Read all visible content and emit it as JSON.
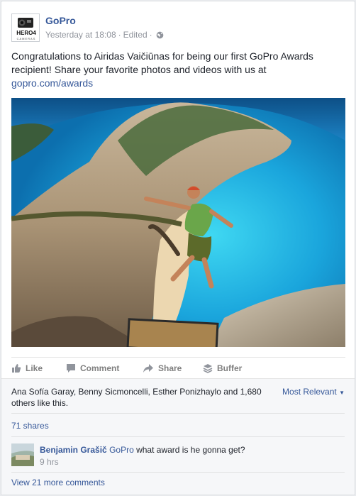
{
  "post": {
    "page_name": "GoPro",
    "timestamp": "Yesterday at 18:08",
    "edited_label": "Edited",
    "separator": "·",
    "audience_icon": "globe-icon",
    "avatar_text_main": "HERO4",
    "avatar_text_sub": "CAMERAS",
    "text": "Congratulations to Airidas Vaičiūnas for being our first GoPro Awards recipient! Share your favorite photos and videos with us at",
    "link": "gopro.com/awards"
  },
  "actions": {
    "like": "Like",
    "comment": "Comment",
    "share": "Share",
    "buffer": "Buffer"
  },
  "summary": {
    "likes_text": "Ana Sofía Garay, Benny Sicmoncelli, Esther Ponizhaylo and 1,680 others like this.",
    "sort_label": "Most Relevant",
    "shares": "71 shares"
  },
  "comments": [
    {
      "author": "Benjamin Grašič",
      "tag": "GoPro",
      "text": "what award is he gonna get?",
      "time": "9 hrs"
    }
  ],
  "view_more": "View 21 more comments",
  "colors": {
    "link": "#365899",
    "meta": "#90949c",
    "action": "#7f7f7f"
  }
}
